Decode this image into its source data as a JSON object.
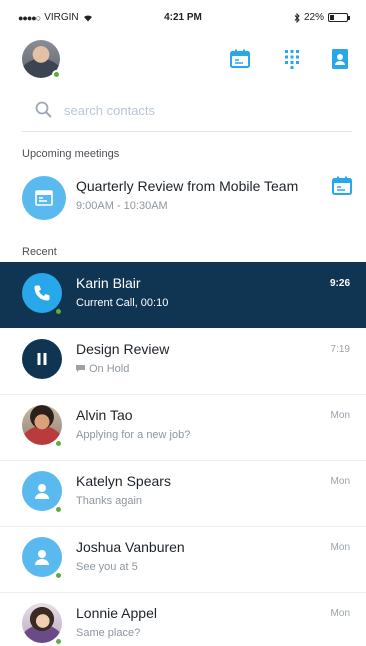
{
  "status_bar": {
    "carrier": "VIRGIN",
    "time": "4:21 PM",
    "battery": "22%",
    "battery_level": 0.22
  },
  "header": {
    "icons": [
      "meetings-calendar-icon",
      "dialpad-icon",
      "contacts-book-icon"
    ]
  },
  "search": {
    "placeholder": "search contacts",
    "value": ""
  },
  "upcoming": {
    "label": "Upcoming meetings",
    "meeting": {
      "title": "Quarterly Review from Mobile Team",
      "time": "9:00AM - 10:30AM"
    }
  },
  "recent": {
    "label": "Recent",
    "items": [
      {
        "name": "Karin Blair",
        "subtitle": "Current Call, 00:10",
        "when": "9:26",
        "kind": "active-call",
        "presence": "online"
      },
      {
        "name": "Design Review",
        "subtitle": "On Hold",
        "when": "7:19",
        "kind": "on-hold"
      },
      {
        "name": "Alvin Tao",
        "subtitle": "Applying for a new job?",
        "when": "Mon",
        "kind": "photo",
        "presence": "online"
      },
      {
        "name": "Katelyn Spears",
        "subtitle": "Thanks again",
        "when": "Mon",
        "kind": "generic",
        "presence": "online"
      },
      {
        "name": "Joshua Vanburen",
        "subtitle": "See you at 5",
        "when": "Mon",
        "kind": "generic",
        "presence": "online"
      },
      {
        "name": "Lonnie Appel",
        "subtitle": "Same place?",
        "when": "Mon",
        "kind": "photo",
        "presence": "online"
      }
    ]
  },
  "colors": {
    "accent": "#28a8ea",
    "active_row": "#0f3553",
    "presence_online": "#5dae3c"
  }
}
